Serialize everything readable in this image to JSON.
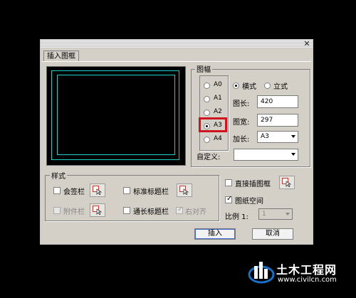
{
  "dialog": {
    "tab_label": "插入图框",
    "close_glyph": "✕",
    "paper_size": {
      "group_label": "图幅",
      "sizes": [
        "A0",
        "A1",
        "A2",
        "A3",
        "A4"
      ],
      "selected": "A3",
      "orientation_landscape": "横式",
      "orientation_portrait": "立式",
      "orientation_selected": "横式",
      "length_label": "图长:",
      "length_value": "420",
      "width_label": "图宽:",
      "width_value": "297",
      "extend_label": "加长:",
      "extend_value": "A3",
      "custom_label": "自定义:",
      "custom_value": ""
    },
    "style": {
      "group_label": "样式",
      "sign_block_label": "会签栏",
      "sign_block_checked": false,
      "standard_title_label": "标准标题栏",
      "standard_title_checked": false,
      "attachment_label": "附件栏",
      "attachment_enabled": false,
      "long_title_label": "通长标题栏",
      "long_title_checked": false,
      "right_align_label": "右对齐",
      "right_align_checked": true,
      "right_align_enabled": false
    },
    "options": {
      "direct_insert_label": "直接插图框",
      "direct_insert_checked": false,
      "paper_space_label": "图纸空间",
      "paper_space_checked": true,
      "scale_label": "比例 1:",
      "scale_value": "1"
    },
    "insert_button": "插入",
    "cancel_button": "取消"
  },
  "watermark": {
    "text": "土木工程网",
    "url": "www.civilcn.com"
  },
  "colors": {
    "dialog_bg": "#d4d0c8",
    "frame_line": "#1fd0c7",
    "highlight": "#d0141f",
    "logo_blue": "#1a6fc4"
  }
}
